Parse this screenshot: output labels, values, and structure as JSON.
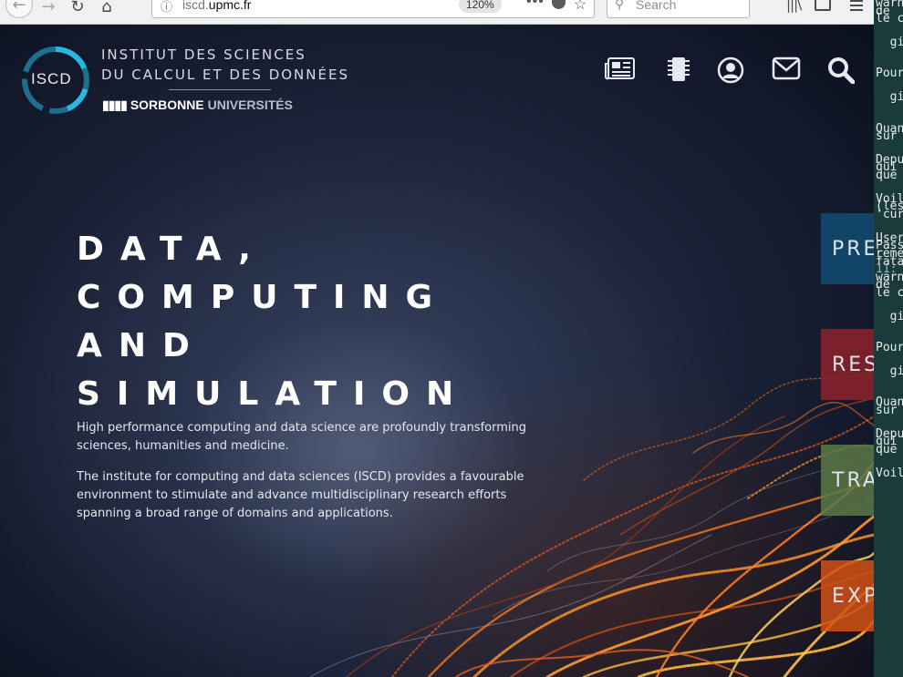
{
  "browser": {
    "url_prefix": "iscd.",
    "url_domain": "upmc.fr",
    "zoom": "120%",
    "search_placeholder": "Search",
    "icons": {
      "back": "back-arrow-icon",
      "forward": "forward-arrow-icon",
      "reload": "reload-icon",
      "home": "home-icon",
      "info": "info-icon",
      "more": "more-icon",
      "pocket": "pocket-icon",
      "bookmark": "star-icon",
      "library": "library-icon",
      "sidebar": "sidebar-icon",
      "menu": "hamburger-menu-icon"
    }
  },
  "site": {
    "logo": {
      "badge": "ISCD",
      "line1": "INSTITUT DES SCIENCES",
      "line2": "DU CALCUL ET DES DONNÉES",
      "university_bold": "SORBONNE",
      "university_light": "UNIVERSITÉS"
    },
    "nav_icons": [
      "newspaper-icon",
      "chip-icon",
      "user-icon",
      "mail-icon",
      "search-icon"
    ],
    "hero": {
      "title_lines": [
        "DATA,",
        "COMPUTING",
        "AND",
        "SIMULATION"
      ],
      "paragraph1": "High performance computing and data science are profoundly transforming sciences, humanities and medicine.",
      "paragraph2": "The institute for computing and data sciences (ISCD) provides a favourable environment to stimulate and advance multidisciplinary research efforts spanning a broad range of domains and applications."
    },
    "side_tabs": [
      {
        "label": "PRE",
        "color": "#12486e"
      },
      {
        "label": "RES",
        "color": "#8c222c"
      },
      {
        "label": "TRA",
        "color": "#5a7846"
      },
      {
        "label": "EXP",
        "color": "#d25014"
      }
    ],
    "colors": {
      "background": "#1a2136",
      "logo_cyan": "#29b6e0",
      "logo_dark": "#1e6f8e"
    }
  },
  "terminal": {
    "lines": [
      "warn",
      "de",
      "le c",
      "",
      "",
      "  gi",
      "",
      "",
      "",
      "Pour",
      "",
      "",
      "  gi",
      "",
      "",
      "",
      "Quan",
      "sur",
      "",
      "",
      "Depu",
      "qui",
      "que",
      "",
      "",
      "Voil",
      "(les",
      "'cur",
      "",
      "",
      "User",
      "Pass",
      "reme",
      "fata",
      "11:",
      "warn",
      "de",
      "le c",
      "",
      "",
      "  gi",
      "",
      "",
      "",
      "Pour",
      "",
      "",
      "  gi",
      "",
      "",
      "",
      "Quan",
      "sur",
      "",
      "",
      "Depu",
      "qui",
      "que",
      "",
      "",
      "Voil"
    ]
  }
}
